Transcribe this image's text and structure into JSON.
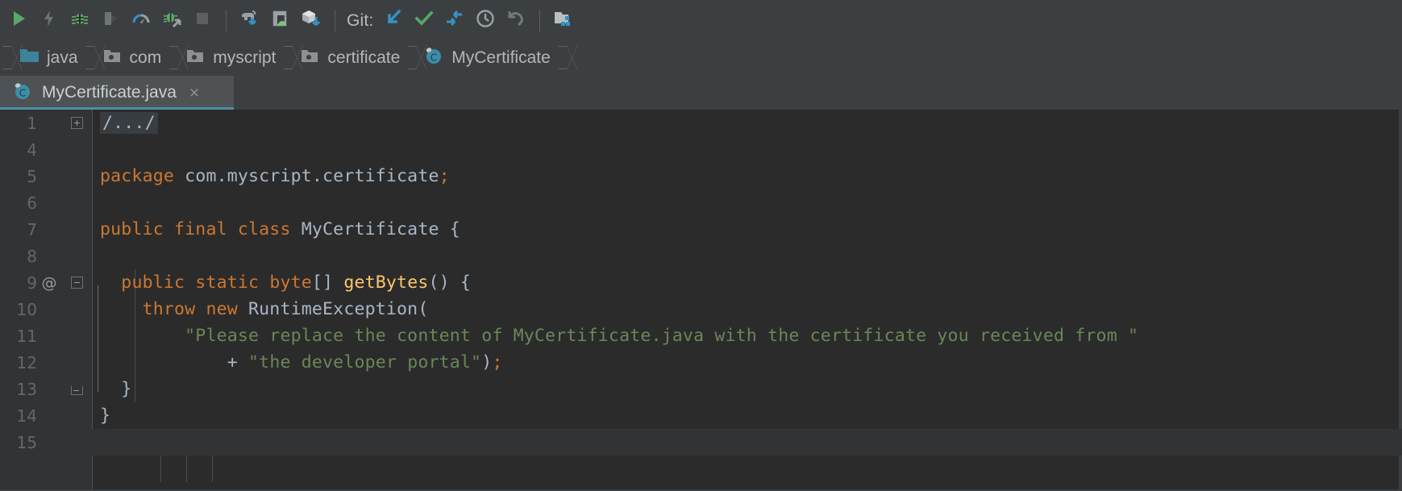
{
  "toolbar": {
    "git_label": "Git:",
    "buttons": [
      {
        "name": "run-button",
        "icon": "run-play-icon"
      },
      {
        "name": "apply-changes-button",
        "icon": "lightning-bolt-icon"
      },
      {
        "name": "debug-button",
        "icon": "bug-icon"
      },
      {
        "name": "attach-debugger-button",
        "icon": "attach-debugger-icon"
      },
      {
        "name": "profiler-button",
        "icon": "profiler-gauge-icon"
      },
      {
        "name": "run-with-coverage-button",
        "icon": "bug-arrow-icon"
      },
      {
        "name": "stop-button",
        "icon": "stop-square-icon"
      },
      {
        "name": "sync-gradle-button",
        "icon": "gradle-elephant-sync-icon"
      },
      {
        "name": "avd-manager-button",
        "icon": "android-device-manager-icon"
      },
      {
        "name": "sdk-manager-button",
        "icon": "sdk-cube-download-icon"
      },
      {
        "name": "git-update-button",
        "icon": "update-project-arrow-icon"
      },
      {
        "name": "git-commit-button",
        "icon": "commit-checkmark-icon"
      },
      {
        "name": "git-push-button",
        "icon": "push-arrow-icon"
      },
      {
        "name": "git-history-button",
        "icon": "history-clock-icon"
      },
      {
        "name": "git-rollback-button",
        "icon": "rollback-undo-icon"
      },
      {
        "name": "project-structure-button",
        "icon": "project-structure-icon"
      }
    ]
  },
  "breadcrumbs": {
    "items": [
      {
        "label": "java",
        "icon": "folder-source-icon"
      },
      {
        "label": "com",
        "icon": "folder-package-icon"
      },
      {
        "label": "myscript",
        "icon": "folder-package-icon"
      },
      {
        "label": "certificate",
        "icon": "folder-package-icon"
      },
      {
        "label": "MyCertificate",
        "icon": "java-class-icon"
      }
    ]
  },
  "tabs": {
    "items": [
      {
        "label": "MyCertificate.java",
        "icon": "java-class-icon",
        "close": "×",
        "active": true
      }
    ]
  },
  "editor": {
    "lines": [
      {
        "num": "1",
        "annotation": "",
        "fold": "plus",
        "text": "/.../",
        "folded": true
      },
      {
        "num": "4",
        "annotation": "",
        "fold": "",
        "text": ""
      },
      {
        "num": "5",
        "annotation": "",
        "fold": "",
        "text": "package com.myscript.certificate;"
      },
      {
        "num": "6",
        "annotation": "",
        "fold": "",
        "text": ""
      },
      {
        "num": "7",
        "annotation": "",
        "fold": "",
        "text": "public final class MyCertificate {"
      },
      {
        "num": "8",
        "annotation": "",
        "fold": "",
        "text": ""
      },
      {
        "num": "9",
        "annotation": "@",
        "fold": "minus",
        "text": "  public static byte[] getBytes() {"
      },
      {
        "num": "10",
        "annotation": "",
        "fold": "",
        "text": "    throw new RuntimeException("
      },
      {
        "num": "11",
        "annotation": "",
        "fold": "",
        "text": "        \"Please replace the content of MyCertificate.java with the certificate you received from \""
      },
      {
        "num": "12",
        "annotation": "",
        "fold": "",
        "text": "            + \"the developer portal\");"
      },
      {
        "num": "13",
        "annotation": "",
        "fold": "end",
        "text": "  }"
      },
      {
        "num": "14",
        "annotation": "",
        "fold": "",
        "text": "}"
      },
      {
        "num": "15",
        "annotation": "",
        "fold": "",
        "text": ""
      }
    ]
  },
  "colors": {
    "keyword": "#cc7832",
    "string": "#6a8759",
    "method": "#ffc66d",
    "plain": "#a9b7c6",
    "editor_bg": "#2b2b2b",
    "chrome_bg": "#3c3f41",
    "tab_active_bg": "#4e5254",
    "tab_underline": "#4e8fa4"
  }
}
